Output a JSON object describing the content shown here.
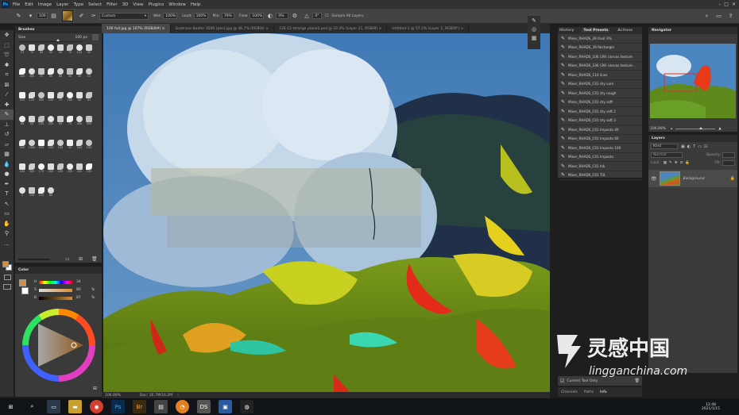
{
  "app": {
    "logo": "Ps"
  },
  "menu": [
    "File",
    "Edit",
    "Image",
    "Layer",
    "Type",
    "Select",
    "Filter",
    "3D",
    "View",
    "Plugins",
    "Window",
    "Help"
  ],
  "options": {
    "brush_size": "100",
    "preset": "Custom",
    "wet_label": "Wet:",
    "wet": "100%",
    "load_label": "Load:",
    "load": "100%",
    "mix_label": "Mix:",
    "mix": "79%",
    "flow_label": "Flow:",
    "flow": "100%",
    "angle": "0%",
    "smoothing": "0°",
    "sample_all": "Sample All Layers"
  },
  "doc_tabs": [
    "106 full.jpg @ 107% (RGB/8#) ×",
    "Gustrave Baxter 3500 (pen).jpg @ 46.7% (RGB/8) ×",
    "135-15 strange plane2.psd @ 33.3% (Layer 21, RGB/8) ×",
    "Untitled-1 @ 57.2% (Layer 1, RGB/8*) ×"
  ],
  "status": {
    "zoom": "106.89%",
    "doc": "Doc: 16.7M/16.2M"
  },
  "brushes_panel": {
    "title": "Brushes",
    "size_label": "Size",
    "size_value": "100 px",
    "sizes": [
      "21",
      "70",
      "80",
      "30",
      "40",
      "70",
      "125",
      "50",
      "200",
      "400",
      "70",
      "60",
      "60",
      "50",
      "30",
      "12",
      "225",
      "125",
      "300",
      "200",
      "70",
      "200",
      "80",
      "81",
      "60",
      "50",
      "150",
      "200",
      "60",
      "70",
      "400",
      "300",
      "300",
      "1000",
      "250",
      "200",
      "100",
      "30",
      "200",
      "100",
      "100",
      "300",
      "175",
      "200",
      "100",
      "200",
      "200",
      "100",
      "2",
      "200",
      "125",
      "80"
    ]
  },
  "color_panel": {
    "title": "Color",
    "h_label": "H",
    "h_value": "34",
    "s_label": "S",
    "s_value": "80",
    "s_unit": "%",
    "b_label": "B",
    "b_value": "87",
    "b_unit": "%"
  },
  "history_tabs": [
    "History",
    "Tool Presets",
    "Actions"
  ],
  "tool_presets": [
    "Mixer_RHADS_39 Oval 3%",
    "Mixer_RHADS_39 Rectangle",
    "Mixer_RHADS_106 (39) canvas texture",
    "Mixer_RHADS_106 (39) canvas texture...",
    "Mixer_RHADS_114 lines",
    "Mixer_RHADS_C01 dry Lum",
    "Mixer_RHADS_C01 dry rough",
    "Mixer_RHADS_C01 dry soft",
    "Mixer_RHADS_C01 dry soft 2",
    "Mixer_RHADS_C01 dry soft 3",
    "Mixer_RHADS_C01 Impasto 40",
    "Mixer_RHADS_C01 Impasto 60",
    "Mixer_RHADS_C01 Impasto 100",
    "Mixer_RHADS_C01 Impasto",
    "Mixer_RHADS_C01 Ink",
    "Mixer_RHADS_C01 Tilt"
  ],
  "current_tool_only": "Current Tool Only",
  "bottom_tabs": [
    "Channels",
    "Paths",
    "Info"
  ],
  "navigator": {
    "title": "Navigator",
    "zoom": "106.89%"
  },
  "layers": {
    "title": "Layers",
    "filter_kind": "Kind",
    "blend": "Normal",
    "opacity_label": "Opacity:",
    "lock_label": "Lock:",
    "fill_label": "Fill:",
    "layer_name": "Background"
  },
  "watermark": {
    "brand": "灵感中国",
    "url": "lingganchina.com"
  },
  "taskbar": {
    "time": "12:48",
    "date": "2021/1/15"
  },
  "colors": {
    "foreground": "#d4903a",
    "background": "#ffffff",
    "accent": "#31a8ff"
  }
}
